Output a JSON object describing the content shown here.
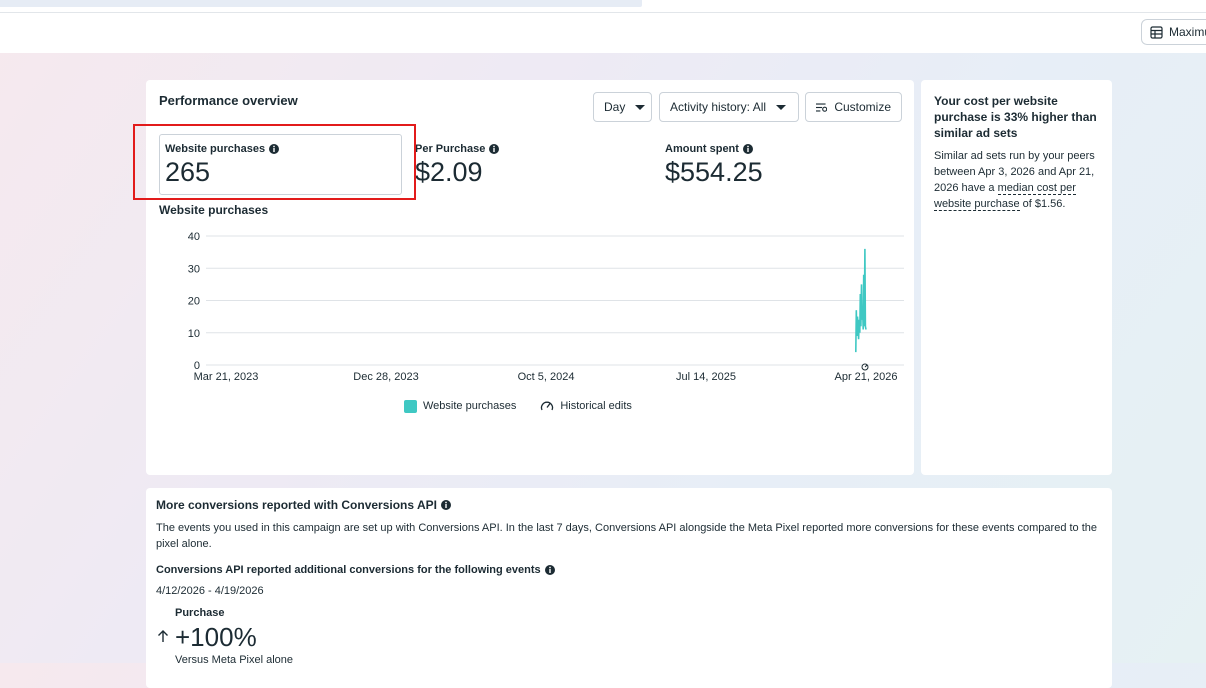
{
  "toolbar": {
    "maximize_label": "Maximu"
  },
  "performance": {
    "title": "Performance overview",
    "day_dropdown": "Day",
    "activity_dropdown": "Activity history: All",
    "customize_label": "Customize",
    "metrics": [
      {
        "label": "Website purchases",
        "value": "265"
      },
      {
        "label": "Per Purchase",
        "value": "$2.09"
      },
      {
        "label": "Amount spent",
        "value": "$554.25"
      }
    ],
    "chart_title": "Website purchases",
    "legend": {
      "series": "Website purchases",
      "edits": "Historical edits"
    }
  },
  "chart_data": {
    "type": "line",
    "yticks": [
      0,
      10,
      20,
      30,
      40
    ],
    "ylim": [
      0,
      40
    ],
    "xticks": [
      "Mar 21, 2023",
      "Dec 28, 2023",
      "Oct 5, 2024",
      "Jul 14, 2025",
      "Apr 21, 2026"
    ],
    "color": "#3fc8c3",
    "series": [
      {
        "name": "Website purchases",
        "points": [
          [
            "Apr 3, 2026",
            4
          ],
          [
            "Apr 4, 2026",
            17
          ],
          [
            "Apr 5, 2026",
            9
          ],
          [
            "Apr 6, 2026",
            15
          ],
          [
            "Apr 7, 2026",
            12
          ],
          [
            "Apr 8, 2026",
            8
          ],
          [
            "Apr 9, 2026",
            14
          ],
          [
            "Apr 10, 2026",
            10
          ],
          [
            "Apr 11, 2026",
            22
          ],
          [
            "Apr 12, 2026",
            12
          ],
          [
            "Apr 13, 2026",
            25
          ],
          [
            "Apr 14, 2026",
            14
          ],
          [
            "Apr 15, 2026",
            18
          ],
          [
            "Apr 16, 2026",
            11
          ],
          [
            "Apr 17, 2026",
            28
          ],
          [
            "Apr 18, 2026",
            12
          ],
          [
            "Apr 19, 2026",
            36
          ],
          [
            "Apr 20, 2026",
            12
          ],
          [
            "Apr 21, 2026",
            11
          ]
        ]
      }
    ]
  },
  "insight": {
    "title": "Your cost per website purchase is 33% higher than similar ad sets",
    "body_pre": "Similar ad sets run by your peers between Apr 3, 2026 and Apr 21, 2026 have a ",
    "body_link": "median cost per website purchase",
    "body_post": " of $1.56."
  },
  "conversions": {
    "title": "More conversions reported with Conversions API",
    "description": "The events you used in this campaign are set up with Conversions API. In the last 7 days, Conversions API alongside the Meta Pixel reported more conversions for these events compared to the pixel alone.",
    "subheading": "Conversions API reported additional conversions for the following events",
    "date_range": "4/12/2026 - 4/19/2026",
    "event_label": "Purchase",
    "event_value": "+100%",
    "event_compare": "Versus Meta Pixel alone"
  }
}
